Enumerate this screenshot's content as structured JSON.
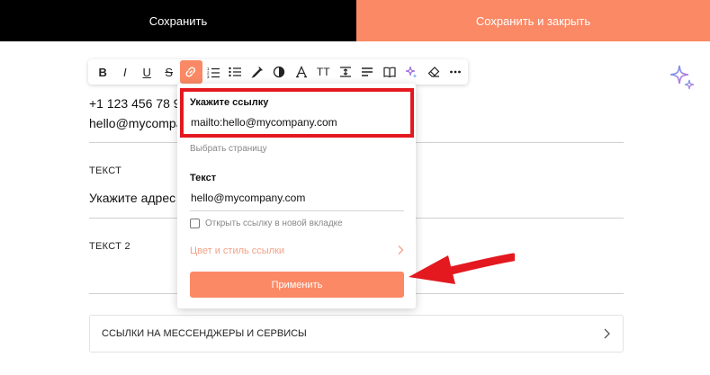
{
  "topbar": {
    "save_label": "Сохранить",
    "save_close_label": "Сохранить и закрыть",
    "save_bg": "#000000",
    "save_close_bg": "#fb8965"
  },
  "toolbar": {
    "bold": "B",
    "italic": "I",
    "underline": "U",
    "strike": "S",
    "text_size": "TT",
    "buttons": [
      "bold",
      "italic",
      "underline",
      "strikethrough",
      "link",
      "ordered-list",
      "bullet-list",
      "text-color",
      "contrast",
      "font",
      "text-size",
      "line-height",
      "align",
      "book",
      "sparkle",
      "eraser",
      "more"
    ],
    "active": "link"
  },
  "editor": {
    "line1": "+1 123 456 78 90",
    "line2": "hello@mycompany.com",
    "section1_label": "ТЕКСТ",
    "section1_text": "Укажите адрес в",
    "section2_label": "ТЕКСТ 2",
    "links_row_label": "ССЫЛКИ НА МЕССЕНДЖЕРЫ И СЕРВИСЫ"
  },
  "link_popup": {
    "link_label": "Укажите ссылку",
    "link_value": "mailto:hello@mycompany.com",
    "choose_page": "Выбрать страницу",
    "text_label": "Текст",
    "text_value": "hello@mycompany.com",
    "open_new_tab": "Открыть ссылку в новой вкладке",
    "style_link": "Цвет и стиль ссылки",
    "apply": "Применить"
  },
  "colors": {
    "accent": "#fb8965",
    "highlight": "#e3191f"
  }
}
